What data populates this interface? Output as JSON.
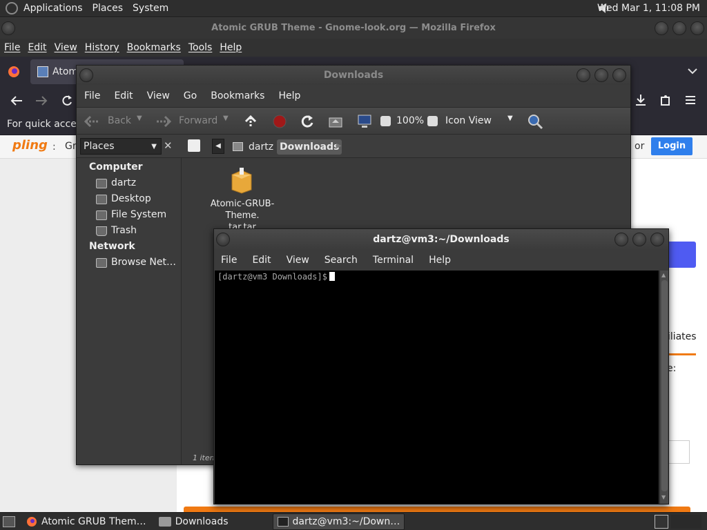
{
  "top_panel": {
    "menu": [
      "Applications",
      "Places",
      "System"
    ],
    "clock": "Wed Mar  1, 11:08 PM"
  },
  "firefox": {
    "title": "Atomic GRUB Theme - Gnome-look.org — Mozilla Firefox",
    "menu": [
      "File",
      "Edit",
      "View",
      "History",
      "Bookmarks",
      "Tools",
      "Help"
    ],
    "tab_label": "Atomi",
    "bookmarks_text": "For quick access,",
    "pling_logo": "pling",
    "pling_partial": "Gr",
    "or_text": "or",
    "login": "Login",
    "filiates": "filiates",
    "e_colon": "e:"
  },
  "nautilus": {
    "title": "Downloads",
    "menu": [
      "File",
      "Edit",
      "View",
      "Go",
      "Bookmarks",
      "Help"
    ],
    "toolbar": {
      "back": "Back",
      "forward": "Forward",
      "zoom": "100%",
      "view_mode": "Icon View"
    },
    "places_label": "Places",
    "breadcrumbs": [
      "dartz",
      "Downloads"
    ],
    "sidebar": {
      "computer_header": "Computer",
      "computer_items": [
        "dartz",
        "Desktop",
        "File System",
        "Trash"
      ],
      "network_header": "Network",
      "network_items": [
        "Browse Net…"
      ]
    },
    "file": {
      "name_line1": "Atomic-GRUB-Theme.",
      "name_line2": "tar.tar"
    },
    "status": "1 item"
  },
  "terminal": {
    "title": "dartz@vm3:~/Downloads",
    "menu": [
      "File",
      "Edit",
      "View",
      "Search",
      "Terminal",
      "Help"
    ],
    "prompt": "[dartz@vm3 Downloads]$"
  },
  "taskbar": {
    "items": [
      "Atomic GRUB Them…",
      "Downloads",
      "dartz@vm3:~/Down…"
    ]
  }
}
